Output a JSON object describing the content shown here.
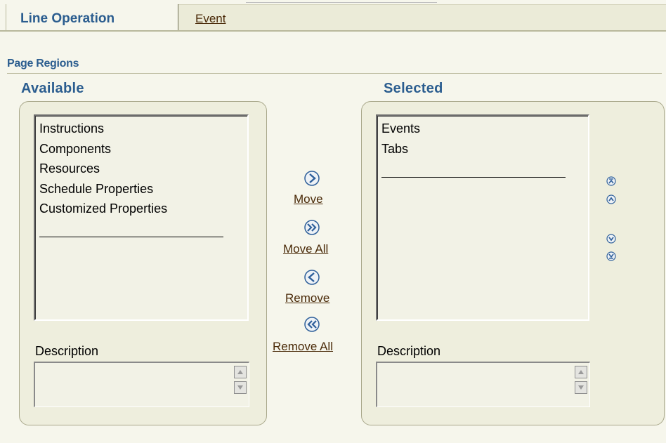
{
  "tabs": {
    "active_label": "Line Operation",
    "inactive_label": "Event"
  },
  "section_title": "Page Regions",
  "available": {
    "title": "Available",
    "items": [
      "Instructions",
      "Components",
      "Resources",
      "Schedule Properties",
      "Customized Properties"
    ],
    "description_label": "Description",
    "description_value": ""
  },
  "selected": {
    "title": "Selected",
    "items": [
      "Events",
      "Tabs"
    ],
    "description_label": "Description",
    "description_value": ""
  },
  "actions": {
    "move": "Move",
    "move_all": "Move All",
    "remove": "Remove",
    "remove_all": "Remove All"
  },
  "reorder_icons": [
    "move-to-top-icon",
    "move-up-icon",
    "move-down-icon",
    "move-to-bottom-icon"
  ],
  "colors": {
    "accent_blue": "#2b5d8f",
    "link_brown": "#4a2a08",
    "background": "#f6f6ec",
    "panel": "#eeeedd"
  }
}
